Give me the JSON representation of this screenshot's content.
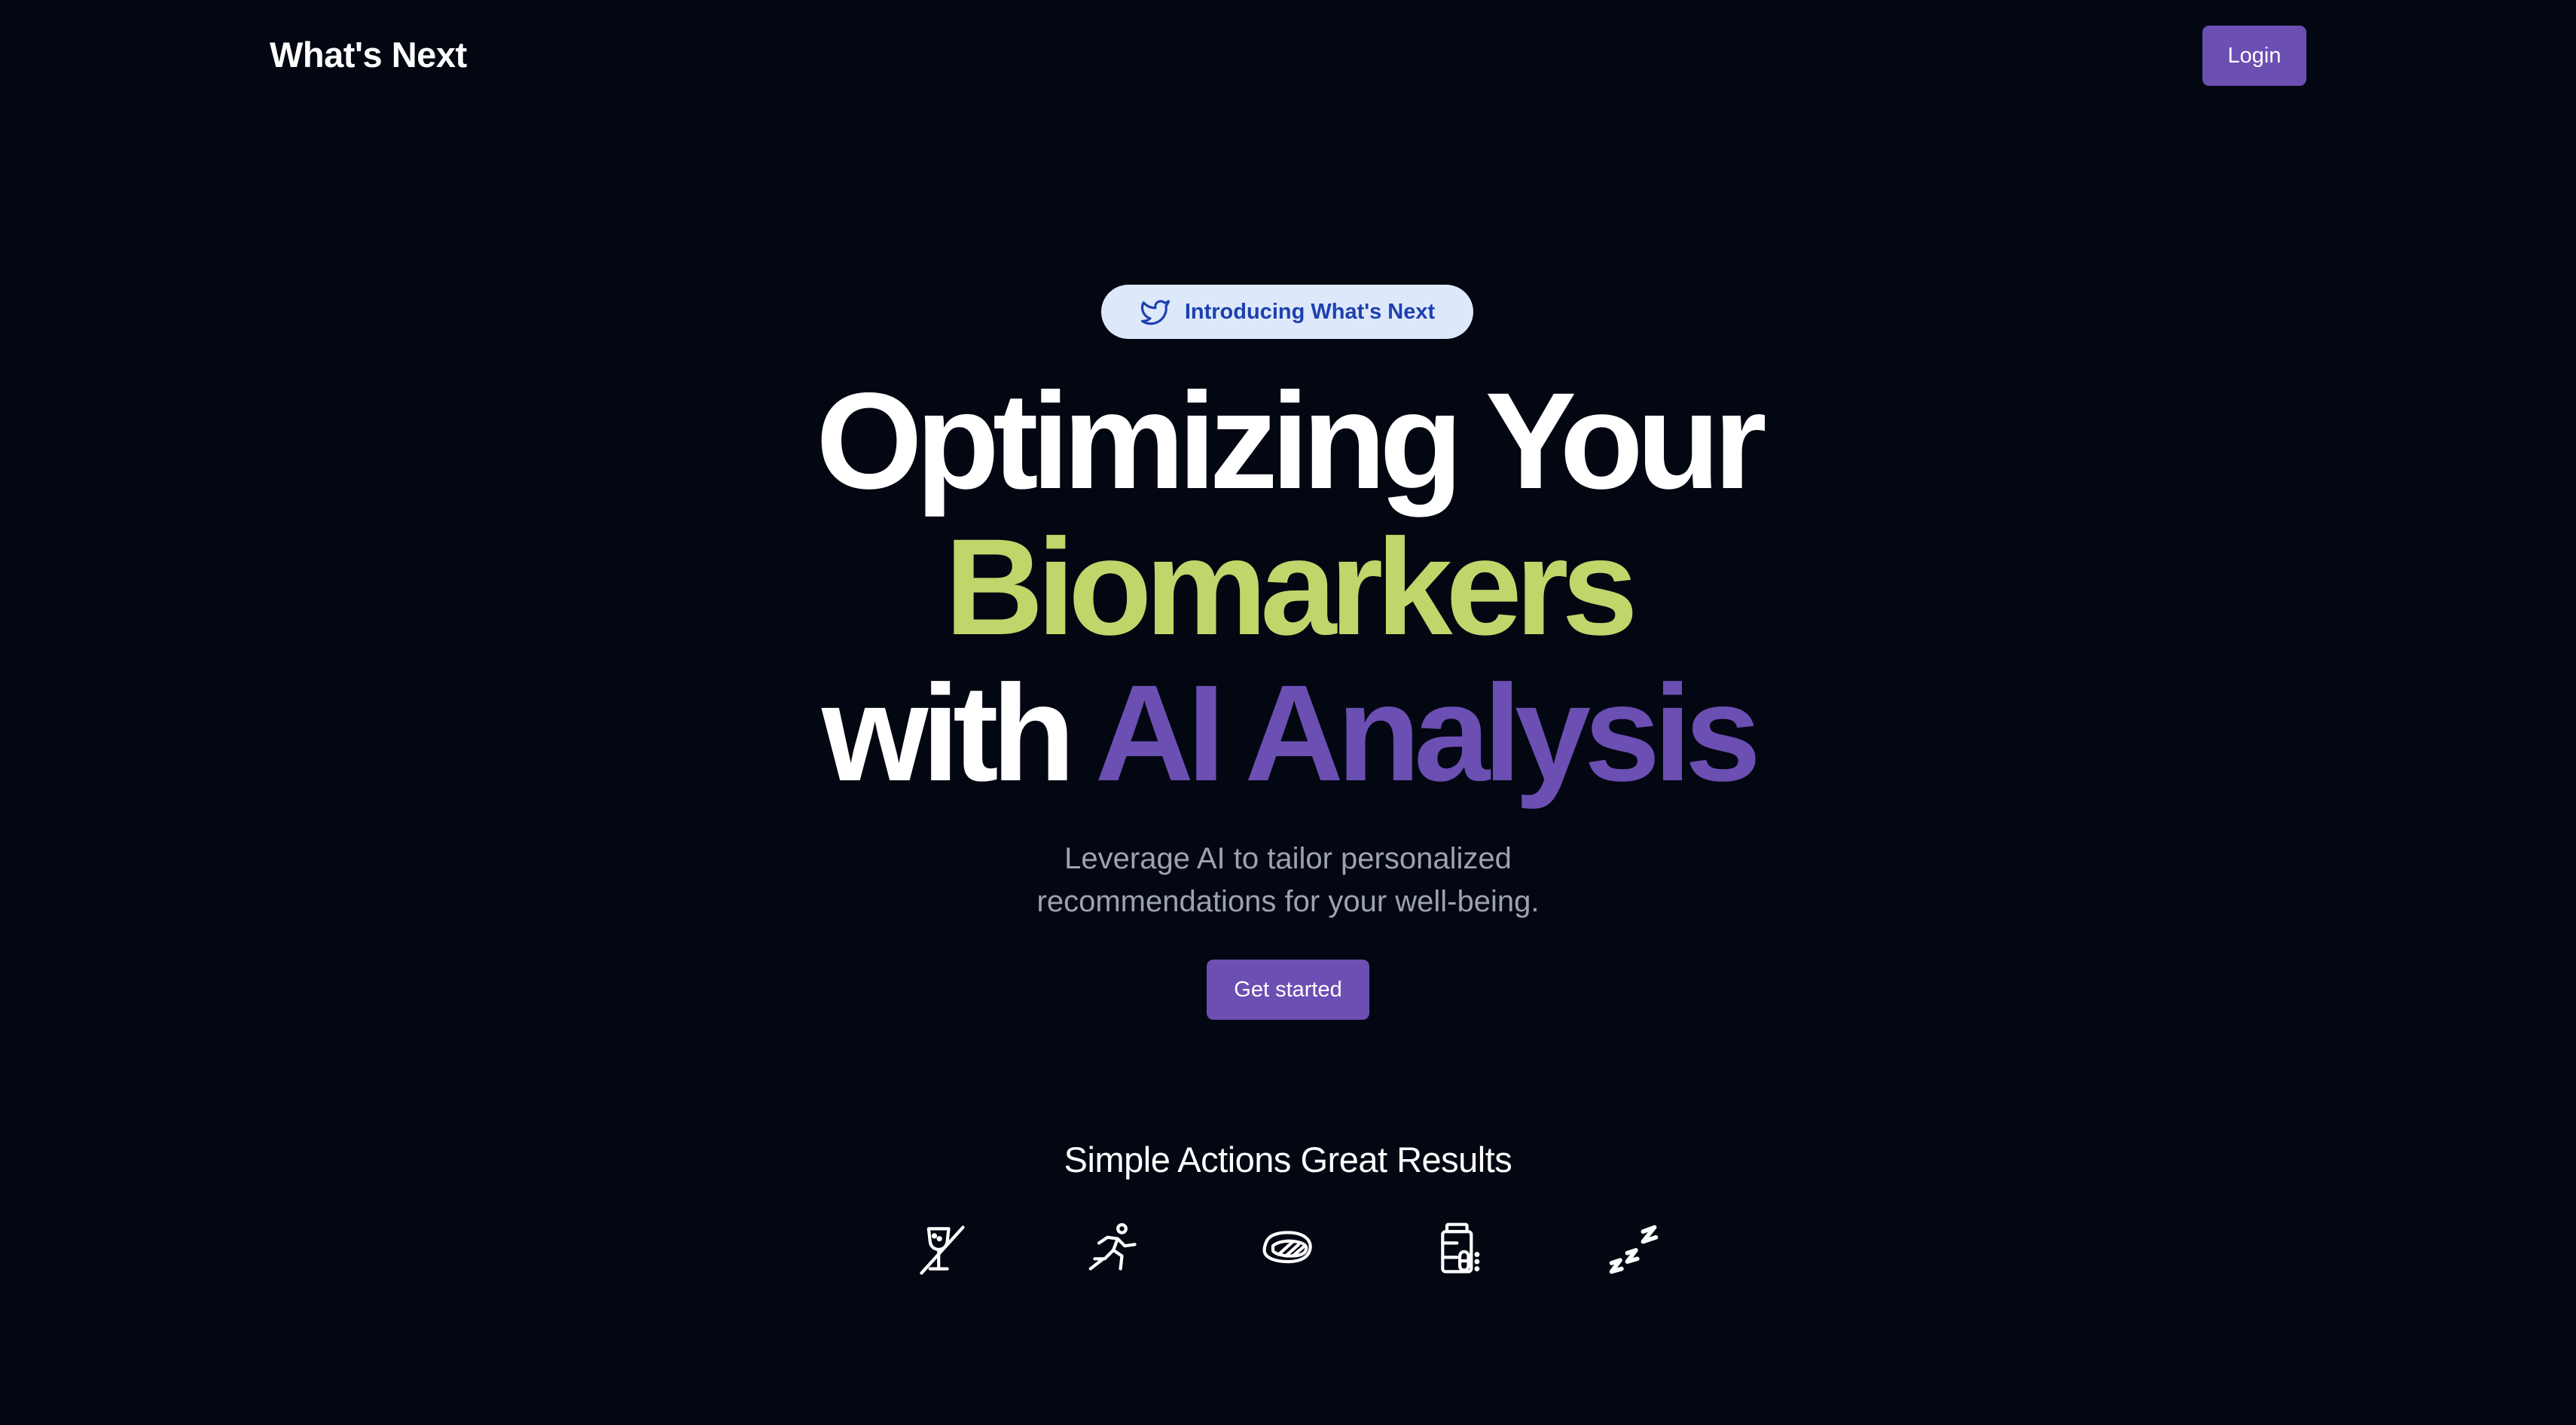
{
  "header": {
    "brand": "What's Next",
    "login_label": "Login"
  },
  "hero": {
    "badge": {
      "icon": "twitter-bird-icon",
      "label": "Introducing What's Next"
    },
    "headline": {
      "line1": "Optimizing Your",
      "line2": "Biomarkers",
      "line3_prefix": "with",
      "line3_highlight": "AI Analysis"
    },
    "subtext_line1": "Leverage AI to tailor personalized",
    "subtext_line2": "recommendations for your well-being.",
    "cta_label": "Get started"
  },
  "actions": {
    "title": "Simple Actions Great Results",
    "icons": [
      "no-alcohol-icon",
      "running-icon",
      "steak-icon",
      "supplement-bottle-icon",
      "sleep-icon"
    ]
  },
  "colors": {
    "background": "#030712",
    "accent_purple": "#6b4fb3",
    "accent_green": "#bfd66a",
    "badge_bg": "#dde8fb",
    "badge_text": "#1e40af",
    "muted_text": "#9ca3af"
  }
}
